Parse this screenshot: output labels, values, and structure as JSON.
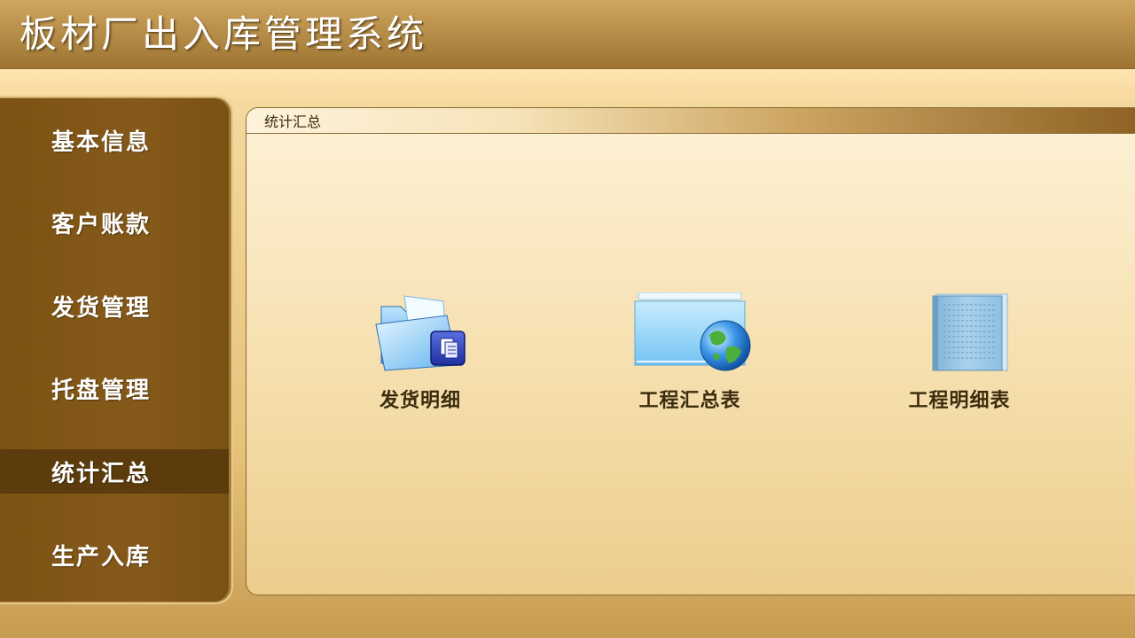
{
  "app": {
    "title": "板材厂出入库管理系统"
  },
  "sidebar": {
    "items": [
      {
        "label": "基本信息",
        "active": false
      },
      {
        "label": "客户账款",
        "active": false
      },
      {
        "label": "发货管理",
        "active": false
      },
      {
        "label": "托盘管理",
        "active": false
      },
      {
        "label": "统计汇总",
        "active": true
      },
      {
        "label": "生产入库",
        "active": false
      }
    ]
  },
  "panel": {
    "title": "统计汇总",
    "tiles": [
      {
        "label": "发货明细",
        "icon": "folder-documents-icon"
      },
      {
        "label": "工程汇总表",
        "icon": "folder-globe-icon"
      },
      {
        "label": "工程明细表",
        "icon": "report-book-icon"
      }
    ]
  },
  "colors": {
    "titlebar": "#b38a45",
    "sidebar": "#85591a",
    "sidebar_active": "#5c3c0c",
    "panel_bg": "#f6dfae",
    "text_dark": "#3b2c0e"
  }
}
